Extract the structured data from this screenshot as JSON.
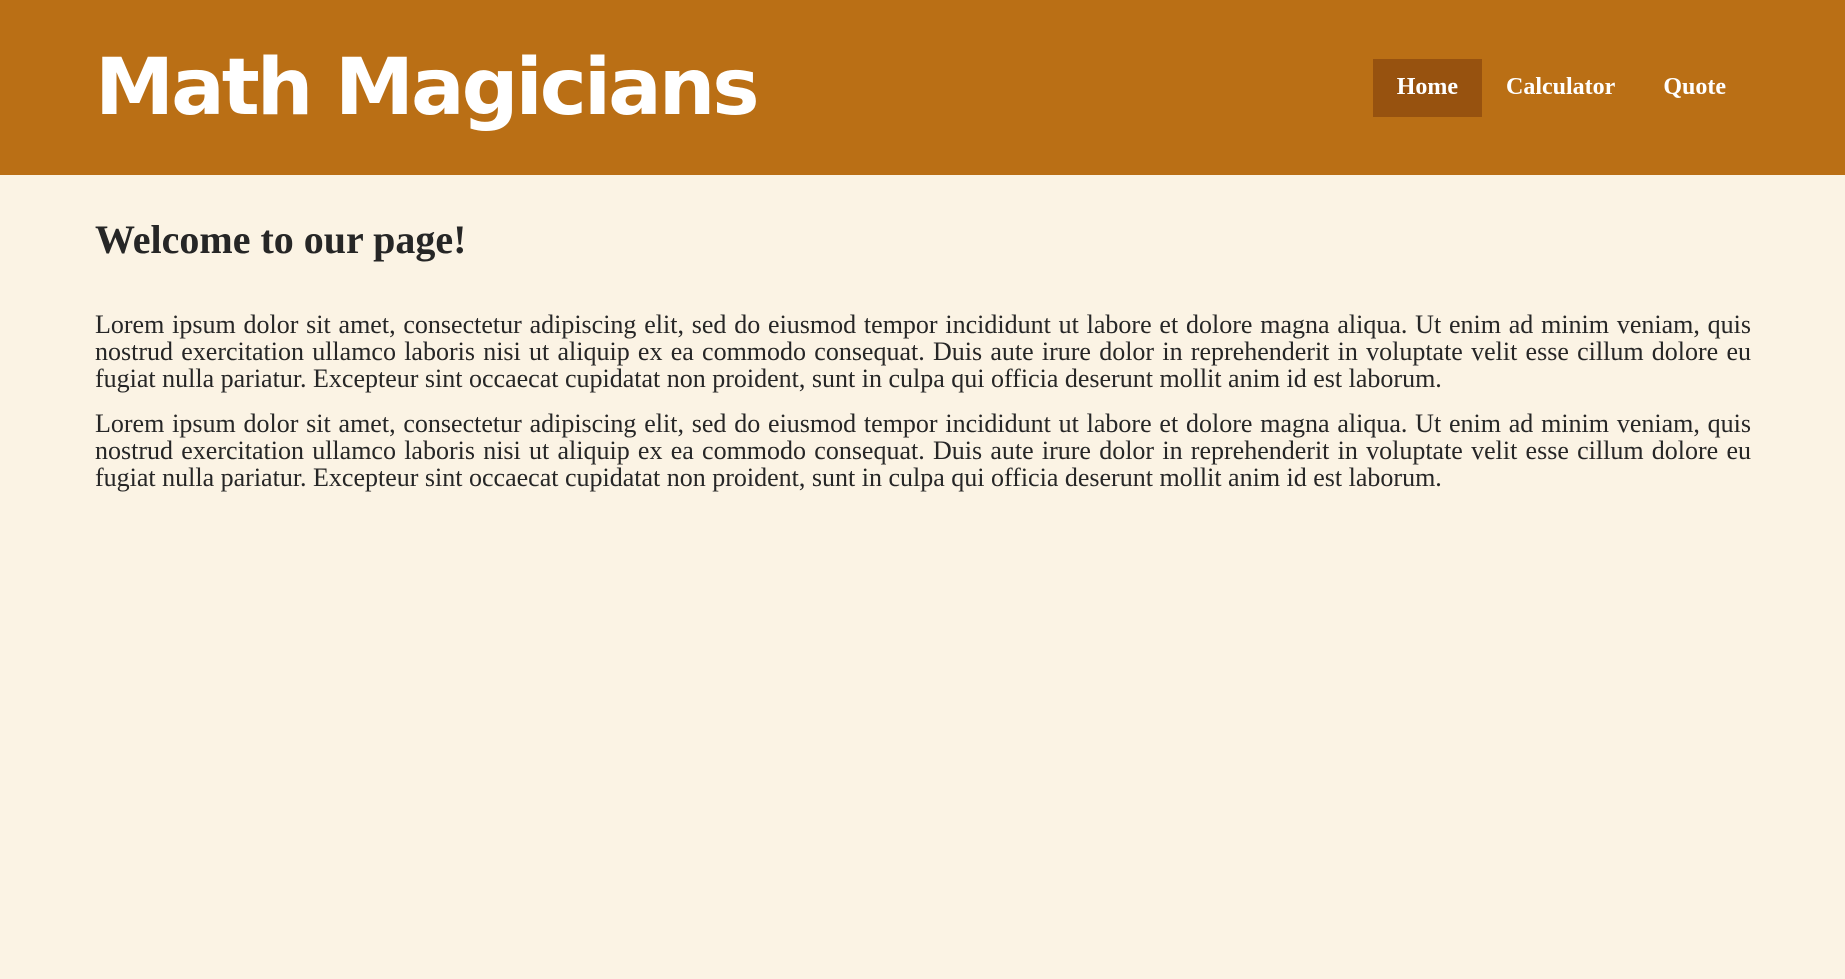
{
  "header": {
    "brand": "Math Magicians",
    "nav": [
      {
        "label": "Home",
        "active": true
      },
      {
        "label": "Calculator",
        "active": false
      },
      {
        "label": "Quote",
        "active": false
      }
    ]
  },
  "main": {
    "title": "Welcome to our page!",
    "paragraphs": [
      "Lorem ipsum dolor sit amet, consectetur adipiscing elit, sed do eiusmod tempor incididunt ut labore et dolore magna aliqua. Ut enim ad minim veniam, quis nostrud exercitation ullamco laboris nisi ut aliquip ex ea commodo consequat. Duis aute irure dolor in reprehenderit in voluptate velit esse cillum dolore eu fugiat nulla pariatur. Excepteur sint occaecat cupidatat non proident, sunt in culpa qui officia deserunt mollit anim id est laborum.",
      "Lorem ipsum dolor sit amet, consectetur adipiscing elit, sed do eiusmod tempor incididunt ut labore et dolore magna aliqua. Ut enim ad minim veniam, quis nostrud exercitation ullamco laboris nisi ut aliquip ex ea commodo consequat. Duis aute irure dolor in reprehenderit in voluptate velit esse cillum dolore eu fugiat nulla pariatur. Excepteur sint occaecat cupidatat non proident, sunt in culpa qui officia deserunt mollit anim id est laborum."
    ]
  },
  "colors": {
    "header_background": "#ba6f15",
    "active_nav_background": "#97520f",
    "page_background": "#fbf3e4",
    "text": "#262626",
    "header_text": "#ffffff"
  }
}
